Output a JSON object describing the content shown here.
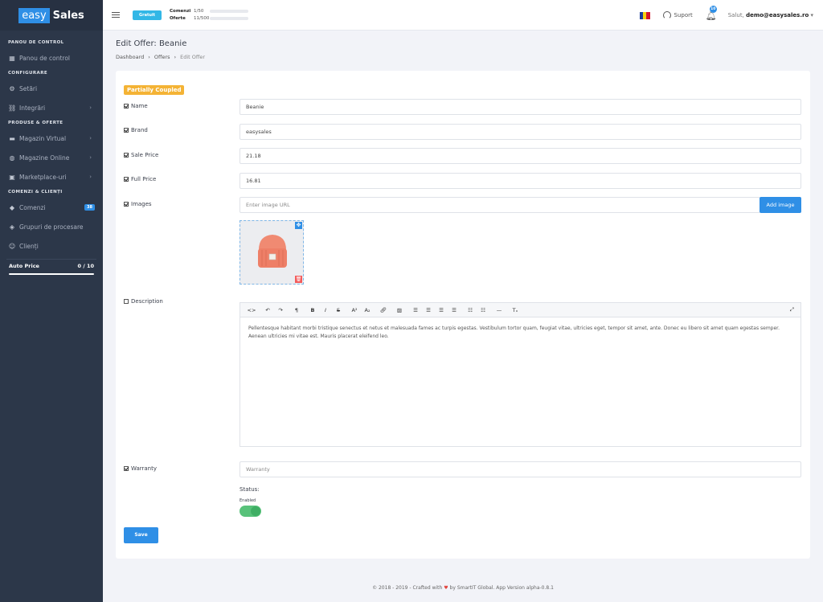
{
  "brand": {
    "easy": "easy",
    "sales": "Sales"
  },
  "sidebar": {
    "sections": {
      "panou": "PANOU DE CONTROL",
      "configurare": "CONFIGURARE",
      "produse": "PRODUSE & OFERTE",
      "comenzi": "COMENZI & CLIENȚI"
    },
    "items": {
      "panou_control": "Panou de control",
      "setari": "Setări",
      "integrari": "Integrări",
      "magazin_virtual": "Magazin Virtual",
      "magazine_online": "Magazine Online",
      "marketplace": "Marketplace-uri",
      "comenzi": "Comenzi",
      "comenzi_badge": "38",
      "grupuri": "Grupuri de procesare",
      "clienti": "Clienți"
    },
    "autoprice": {
      "label": "Auto Price",
      "count": "0 / 10"
    }
  },
  "topbar": {
    "plan": "Gratuit",
    "comenzi_label": "Comenzi",
    "comenzi_value": "1/50",
    "oferte_label": "Oferte",
    "oferte_value": "11/500",
    "support": "Suport",
    "notifications": "10",
    "greeting": "Salut,",
    "user": "demo@easysales.ro"
  },
  "page": {
    "title": "Edit Offer: Beanie",
    "breadcrumb": [
      "Dashboard",
      "Offers",
      "Edit Offer"
    ]
  },
  "form": {
    "coupled_badge": "Partially Coupled",
    "name": {
      "label": "Name",
      "value": "Beanie"
    },
    "brand": {
      "label": "Brand",
      "value": "easysales"
    },
    "sale_price": {
      "label": "Sale Price",
      "value": "21.18"
    },
    "full_price": {
      "label": "Full Price",
      "value": "16.81"
    },
    "images": {
      "label": "Images",
      "placeholder": "Enter image URL",
      "add_label": "Add image"
    },
    "description": {
      "label": "Description",
      "text": "Pellentesque habitant morbi tristique senectus et netus et malesuada fames ac turpis egestas. Vestibulum tortor quam, feugiat vitae, ultricies eget, tempor sit amet, ante. Donec eu libero sit amet quam egestas semper. Aenean ultricies mi vitae est. Mauris placerat eleifend leo."
    },
    "warranty": {
      "label": "Warranty",
      "placeholder": "Warranty"
    },
    "status": {
      "label": "Status:",
      "state": "Enabled"
    },
    "save_label": "Save"
  },
  "footer": {
    "prefix": "© 2018 - 2019 - Crafted with",
    "suffix": "by SmartIT Global. App Version alpha-0.8.1"
  },
  "colors": {
    "sidebar": "#2c3749",
    "primary": "#2f8fe6",
    "coupled": "#f4b335",
    "toggle": "#58c27a"
  }
}
